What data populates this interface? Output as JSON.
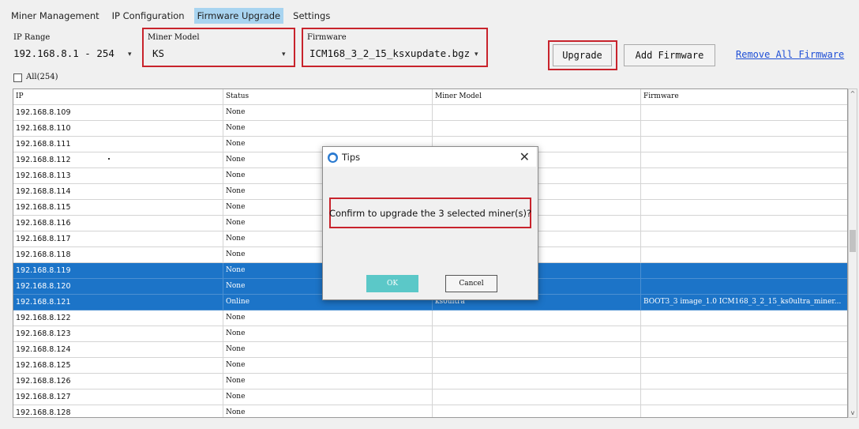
{
  "tabs": [
    "Miner Management",
    "IP Configuration",
    "Firmware Upgrade",
    "Settings"
  ],
  "active_tab": "Firmware Upgrade",
  "form": {
    "ip_range_label": "IP Range",
    "ip_range_value": "192.168.8.1 - 254",
    "miner_model_label": "Miner Model",
    "miner_model_value": "KS",
    "firmware_label": "Firmware",
    "firmware_value": "ICM168_3_2_15_ksxupdate.bgz",
    "upgrade_button": "Upgrade",
    "add_firmware_button": "Add Firmware",
    "remove_all_link": "Remove All Firmware",
    "select_all_label": "All(254)"
  },
  "table": {
    "headers": [
      "IP",
      "Status",
      "Miner Model",
      "Firmware"
    ],
    "rows": [
      {
        "ip": "192.168.8.109",
        "status": "None",
        "model": "",
        "firmware": "",
        "selected": false
      },
      {
        "ip": "192.168.8.110",
        "status": "None",
        "model": "",
        "firmware": "",
        "selected": false
      },
      {
        "ip": "192.168.8.111",
        "status": "None",
        "model": "",
        "firmware": "",
        "selected": false
      },
      {
        "ip": "192.168.8.112",
        "status": "None",
        "model": "",
        "firmware": "",
        "selected": false
      },
      {
        "ip": "192.168.8.113",
        "status": "None",
        "model": "",
        "firmware": "",
        "selected": false
      },
      {
        "ip": "192.168.8.114",
        "status": "None",
        "model": "",
        "firmware": "",
        "selected": false
      },
      {
        "ip": "192.168.8.115",
        "status": "None",
        "model": "",
        "firmware": "",
        "selected": false
      },
      {
        "ip": "192.168.8.116",
        "status": "None",
        "model": "",
        "firmware": "",
        "selected": false
      },
      {
        "ip": "192.168.8.117",
        "status": "None",
        "model": "",
        "firmware": "",
        "selected": false
      },
      {
        "ip": "192.168.8.118",
        "status": "None",
        "model": "",
        "firmware": "",
        "selected": false
      },
      {
        "ip": "192.168.8.119",
        "status": "None",
        "model": "",
        "firmware": "",
        "selected": true
      },
      {
        "ip": "192.168.8.120",
        "status": "None",
        "model": "",
        "firmware": "",
        "selected": true
      },
      {
        "ip": "192.168.8.121",
        "status": "Online",
        "model": "ks0ultra",
        "firmware": "BOOT3_3 image_1.0 ICM168_3_2_15_ks0ultra_miner...",
        "selected": true
      },
      {
        "ip": "192.168.8.122",
        "status": "None",
        "model": "",
        "firmware": "",
        "selected": false
      },
      {
        "ip": "192.168.8.123",
        "status": "None",
        "model": "",
        "firmware": "",
        "selected": false
      },
      {
        "ip": "192.168.8.124",
        "status": "None",
        "model": "",
        "firmware": "",
        "selected": false
      },
      {
        "ip": "192.168.8.125",
        "status": "None",
        "model": "",
        "firmware": "",
        "selected": false
      },
      {
        "ip": "192.168.8.126",
        "status": "None",
        "model": "",
        "firmware": "",
        "selected": false
      },
      {
        "ip": "192.168.8.127",
        "status": "None",
        "model": "",
        "firmware": "",
        "selected": false
      },
      {
        "ip": "192.168.8.128",
        "status": "None",
        "model": "",
        "firmware": "",
        "selected": false
      }
    ]
  },
  "dialog": {
    "title": "Tips",
    "message": "Confirm to upgrade the 3 selected miner(s)?",
    "ok": "OK",
    "cancel": "Cancel"
  },
  "colors": {
    "selection": "#1c74c8",
    "highlight_box": "#c8232c",
    "active_tab": "#a8d4f0",
    "ok_button": "#5bc8c8",
    "link": "#1f4fd6"
  }
}
